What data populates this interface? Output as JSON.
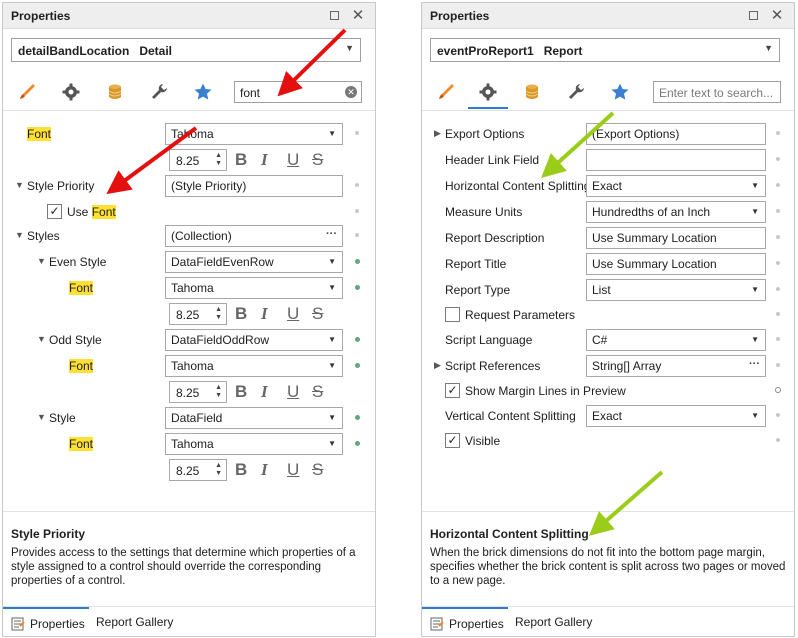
{
  "colors": {
    "accent": "#2b7bd1",
    "highlight": "#ffe033",
    "red_arrow": "#e41010",
    "green_arrow": "#9acd1a"
  },
  "left_panel": {
    "title": "Properties",
    "object_selector": "detailBandLocation   Detail",
    "search_value": "font",
    "rows": {
      "font": {
        "label": "Font",
        "font_value": "Tahoma",
        "size": "8.25"
      },
      "style_priority": {
        "label": "Style Priority",
        "value": "(Style Priority)"
      },
      "use_font": {
        "prefix": "Use ",
        "highlight": "Font"
      },
      "styles": {
        "label": "Styles",
        "value": "(Collection)"
      },
      "even_style": {
        "label": "Even Style",
        "value": "DataFieldEvenRow",
        "font_label": "Font",
        "font_value": "Tahoma",
        "size": "8.25"
      },
      "odd_style": {
        "label": "Odd Style",
        "value": "DataFieldOddRow",
        "font_label": "Font",
        "font_value": "Tahoma",
        "size": "8.25"
      },
      "style": {
        "label": "Style",
        "value": "DataField",
        "font_label": "Font",
        "font_value": "Tahoma",
        "size": "8.25"
      }
    },
    "format_buttons": {
      "bold": "B",
      "italic": "I",
      "underline": "U",
      "strike": "S"
    },
    "description": {
      "title": "Style Priority",
      "text": "Provides access to the settings that determine which properties of a style assigned to a control should override the corresponding properties of a control."
    },
    "footer_tabs": [
      "Properties",
      "Report Gallery"
    ]
  },
  "right_panel": {
    "title": "Properties",
    "object_selector": "eventProReport1   Report",
    "search_placeholder": "Enter text to search...",
    "rows": [
      {
        "label": "Export Options",
        "value": "(Export Options)"
      },
      {
        "label": "Header Link Field",
        "value": ""
      },
      {
        "label": "Horizontal Content Splitting",
        "value": "Exact"
      },
      {
        "label": "Measure Units",
        "value": "Hundredths of an Inch"
      },
      {
        "label": "Report Description",
        "value": "Use Summary Location"
      },
      {
        "label": "Report Title",
        "value": "Use Summary Location"
      },
      {
        "label": "Report Type",
        "value": "List"
      },
      {
        "label": "Request Parameters",
        "checked": false
      },
      {
        "label": "Script Language",
        "value": "C#"
      },
      {
        "label": "Script References",
        "value": "String[] Array"
      },
      {
        "label": "Show Margin Lines in Preview",
        "checked": true
      },
      {
        "label": "Vertical Content Splitting",
        "value": "Exact"
      },
      {
        "label": "Visible",
        "checked": true
      }
    ],
    "description": {
      "title": "Horizontal Content Splitting",
      "text": "When the brick dimensions do not fit into the bottom page margin, specifies whether the brick content is split across two pages or moved to a new page."
    },
    "footer_tabs": [
      "Properties",
      "Report Gallery"
    ]
  },
  "icons": [
    "brush-icon",
    "gear-icon",
    "database-icon",
    "wrench-icon",
    "star-icon",
    "clear-search-icon",
    "float-window-icon",
    "close-icon"
  ]
}
